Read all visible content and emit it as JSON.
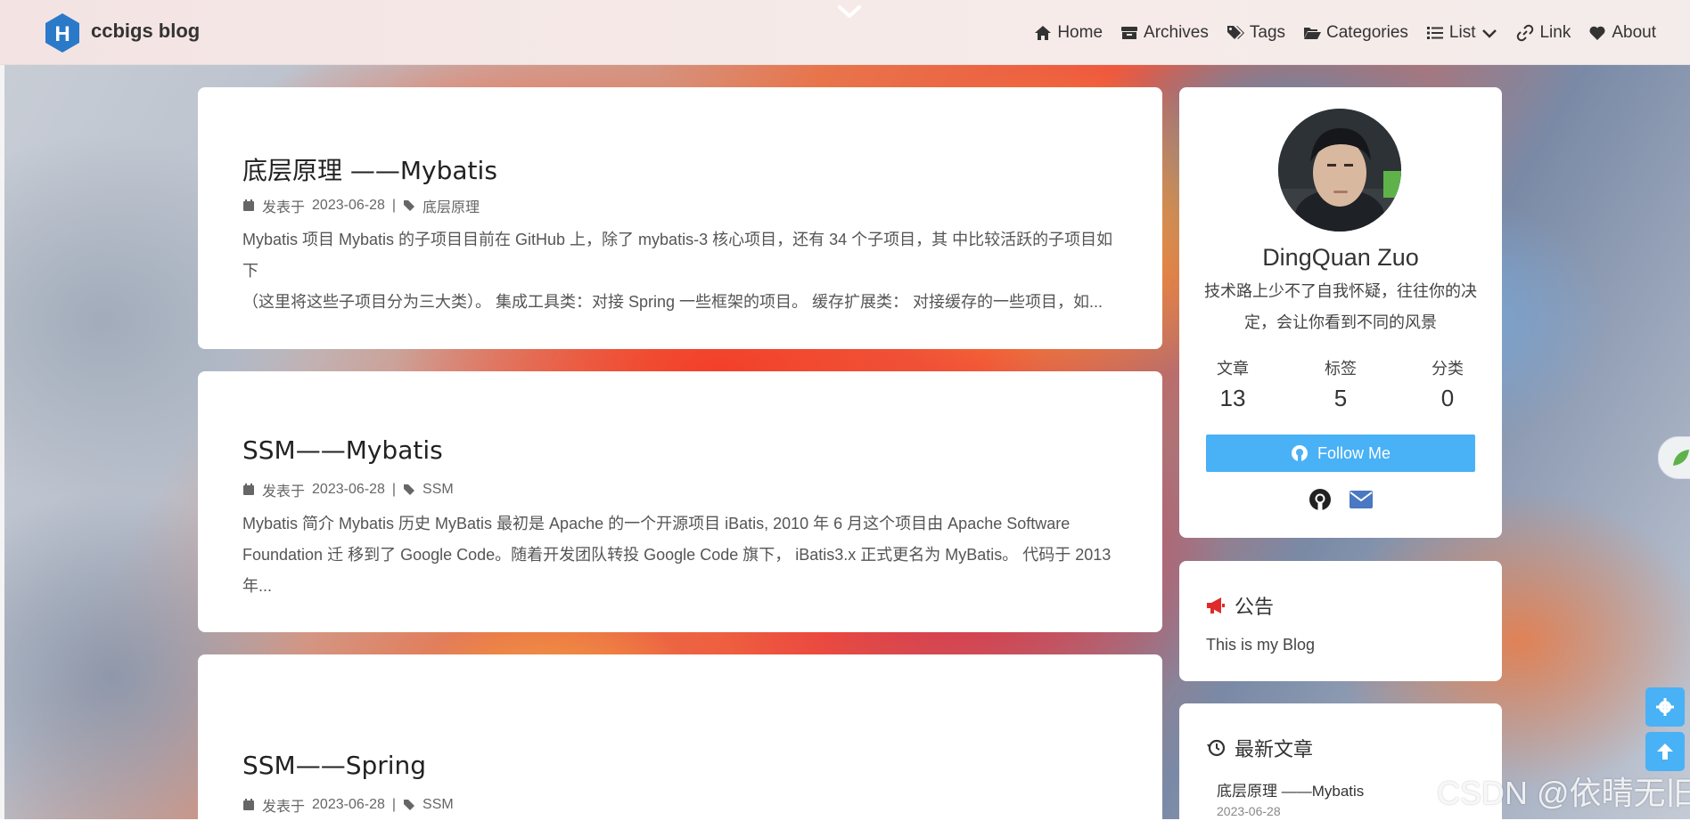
{
  "site": {
    "brand": "ccbigs blog"
  },
  "nav": {
    "items": [
      {
        "label": "Home",
        "icon": "home-icon"
      },
      {
        "label": "Archives",
        "icon": "archive-icon"
      },
      {
        "label": "Tags",
        "icon": "tags-icon"
      },
      {
        "label": "Categories",
        "icon": "folder-open-icon"
      },
      {
        "label": "List",
        "icon": "list-icon"
      },
      {
        "label": "Link",
        "icon": "link-icon"
      },
      {
        "label": "About",
        "icon": "heart-icon"
      }
    ]
  },
  "posts": [
    {
      "title": "底层原理 ——Mybatis",
      "date_prefix": "发表于",
      "date": "2023-06-28",
      "separator": "|",
      "category": "底层原理",
      "excerpt_line1": "Mybatis 项目 Mybatis 的子项目目前在 GitHub 上，除了 mybatis-3 核心项目，还有 34 个子项目，其 中比较活跃的子项目如下",
      "excerpt_line2": "（这里将这些子项目分为三大类）。 集成工具类：对接 Spring 一些框架的项目。 缓存扩展类： 对接缓存的一些项目，如..."
    },
    {
      "title": "SSM——Mybatis",
      "date_prefix": "发表于",
      "date": "2023-06-28",
      "separator": "|",
      "category": "SSM",
      "excerpt_line1": "Mybatis 简介 Mybatis 历史 MyBatis 最初是 Apache 的一个开源项目 iBatis, 2010 年 6 月这个项目由 Apache Software",
      "excerpt_line2": "Foundation 迁 移到了 Google Code。随着开发团队转投 Google Code 旗下， iBatis3.x 正式更名为 MyBatis。 代码于 2013 年..."
    },
    {
      "title": "SSM——Spring",
      "date_prefix": "发表于",
      "date": "2023-06-28",
      "separator": "|",
      "category": "SSM"
    }
  ],
  "author": {
    "name": "DingQuan Zuo",
    "desc_line1": "技术路上少不了自我怀疑，往往你的决",
    "desc_line2": "定，会让你看到不同的风景",
    "stats": [
      {
        "label": "文章",
        "value": "13"
      },
      {
        "label": "标签",
        "value": "5"
      },
      {
        "label": "分类",
        "value": "0"
      }
    ],
    "follow_label": "Follow Me"
  },
  "announcement": {
    "title": "公告",
    "text": "This is my Blog"
  },
  "recent": {
    "title": "最新文章",
    "items": [
      {
        "title": "底层原理 ——Mybatis",
        "date": "2023-06-28"
      }
    ]
  },
  "watermark": "CSDN @依晴无旧",
  "colors": {
    "accent": "#49b1f5",
    "announcement_icon": "#e02a2a",
    "mail_icon": "#4a78c2"
  }
}
